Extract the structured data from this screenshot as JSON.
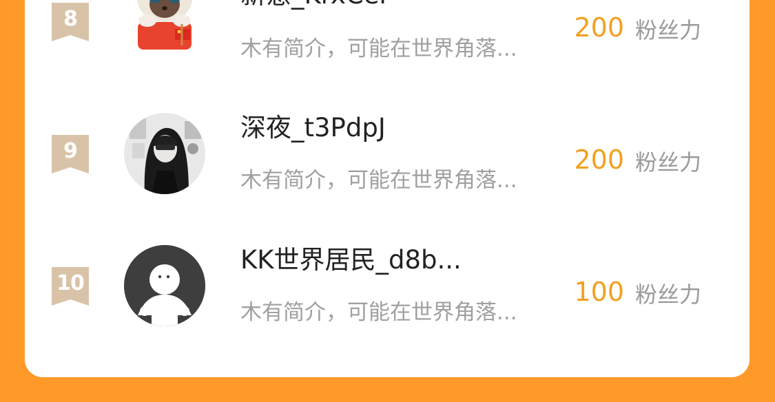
{
  "entries": [
    {
      "rank": "8",
      "name": "新意_KrxCei",
      "bio": "木有简介，可能在世界角落...",
      "score": "200",
      "unit": "粉丝力",
      "avatar": "cat-avatar-icon"
    },
    {
      "rank": "9",
      "name": "深夜_t3PdpJ",
      "bio": "木有简介，可能在世界角落...",
      "score": "200",
      "unit": "粉丝力",
      "avatar": "hooded-person-avatar"
    },
    {
      "rank": "10",
      "name": "KK世界居民_d8b...",
      "bio": "木有简介，可能在世界角落...",
      "score": "100",
      "unit": "粉丝力",
      "avatar": "default-user-avatar-icon"
    }
  ],
  "colors": {
    "background": "#FF9A2A",
    "card": "#FFFFFF",
    "rank_badge": "#D9C3A8",
    "score": "#F2A020",
    "bio": "#A0A0A0"
  }
}
